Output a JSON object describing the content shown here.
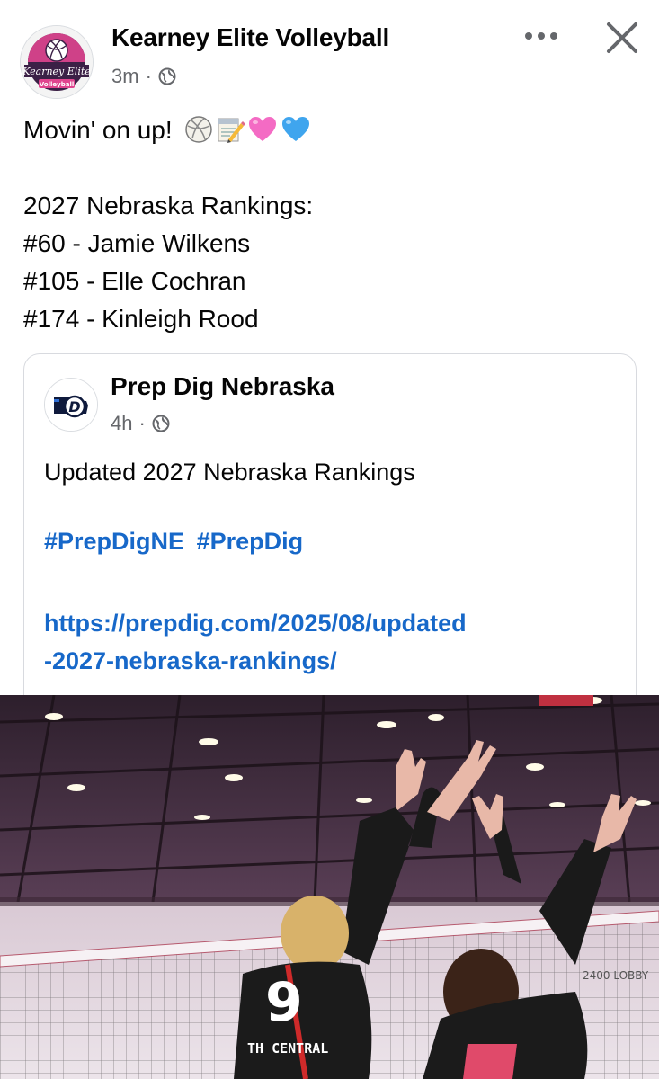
{
  "post": {
    "author": "Kearney Elite Volleyball",
    "avatar_text_top": "Kearney Elite",
    "avatar_text_bottom": "Volleyball",
    "time": "3m",
    "dot": "·",
    "more_icon": "more-options-icon",
    "close_icon": "close-icon",
    "lines": [
      "Movin' on up!",
      "",
      "2027 Nebraska Rankings:",
      "#60 - Jamie Wilkens",
      "#105 - Elle Cochran",
      "#174 - Kinleigh Rood"
    ],
    "emojis": [
      "volleyball-icon",
      "memo-icon",
      "pink-heart-icon",
      "blue-heart-icon"
    ]
  },
  "shared": {
    "author": "Prep Dig Nebraska",
    "time": "4h",
    "dot": "·",
    "text": "Updated 2027 Nebraska Rankings",
    "hashtags": [
      "#PrepDigNE",
      "#PrepDig"
    ],
    "link_line1": "https://prepdig.com/2025/08/updated",
    "link_line2": "-2027-nebraska-rankings/"
  },
  "photo": {
    "jersey_number": "9",
    "jersey_text": "TH CENTRAL",
    "wall_sign": "2400 LOBBY"
  },
  "colors": {
    "link": "#1768c9",
    "meta": "#65676b",
    "text": "#050505",
    "card_border": "#d8dadf"
  }
}
